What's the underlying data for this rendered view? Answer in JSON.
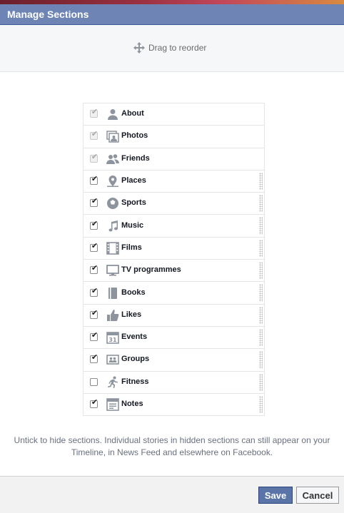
{
  "dialog": {
    "title": "Manage Sections",
    "drag_hint": "Drag to reorder",
    "note_line1": "Untick to hide sections. Individual stories in hidden sections can still appear on your",
    "note_line2": "Timeline, in News Feed and elsewhere on Facebook.",
    "save_label": "Save",
    "cancel_label": "Cancel"
  },
  "sections": [
    {
      "label": "About",
      "icon": "person-icon",
      "checked": true,
      "locked": true
    },
    {
      "label": "Photos",
      "icon": "photos-icon",
      "checked": true,
      "locked": true
    },
    {
      "label": "Friends",
      "icon": "friends-icon",
      "checked": true,
      "locked": true
    },
    {
      "label": "Places",
      "icon": "map-pin-icon",
      "checked": true,
      "locked": false
    },
    {
      "label": "Sports",
      "icon": "soccer-ball-icon",
      "checked": true,
      "locked": false
    },
    {
      "label": "Music",
      "icon": "music-note-icon",
      "checked": true,
      "locked": false
    },
    {
      "label": "Films",
      "icon": "film-strip-icon",
      "checked": true,
      "locked": false
    },
    {
      "label": "TV programmes",
      "icon": "tv-icon",
      "checked": true,
      "locked": false
    },
    {
      "label": "Books",
      "icon": "book-icon",
      "checked": true,
      "locked": false
    },
    {
      "label": "Likes",
      "icon": "thumbs-up-icon",
      "checked": true,
      "locked": false
    },
    {
      "label": "Events",
      "icon": "calendar-icon",
      "checked": true,
      "locked": false
    },
    {
      "label": "Groups",
      "icon": "group-icon",
      "checked": true,
      "locked": false
    },
    {
      "label": "Fitness",
      "icon": "running-person-icon",
      "checked": false,
      "locked": false
    },
    {
      "label": "Notes",
      "icon": "notes-icon",
      "checked": true,
      "locked": false
    }
  ],
  "colors": {
    "header": "#6d84b4",
    "icon": "#8d949e",
    "save": "#5b74a8"
  }
}
